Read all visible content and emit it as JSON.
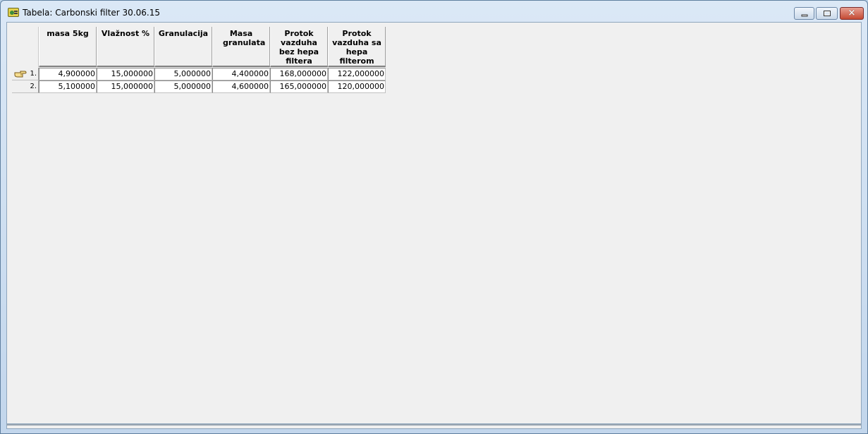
{
  "window": {
    "title": "Tabela: Carbonski filter 30.06.15"
  },
  "table": {
    "columns": [
      "masa 5kg",
      "Vlažnost %",
      "Granulacija",
      "Masa granulata",
      "Protok vazduha bez hepa filtera",
      "Protok vazduha sa hepa filterom"
    ],
    "rows": [
      {
        "label": "1.",
        "cells": [
          "4,900000",
          "15,000000",
          "5,000000",
          "4,400000",
          "168,000000",
          "122,000000"
        ]
      },
      {
        "label": "2.",
        "cells": [
          "5,100000",
          "15,000000",
          "5,000000",
          "4,600000",
          "165,000000",
          "120,000000"
        ]
      }
    ],
    "current_row_icon": "pointing-hand-icon"
  }
}
